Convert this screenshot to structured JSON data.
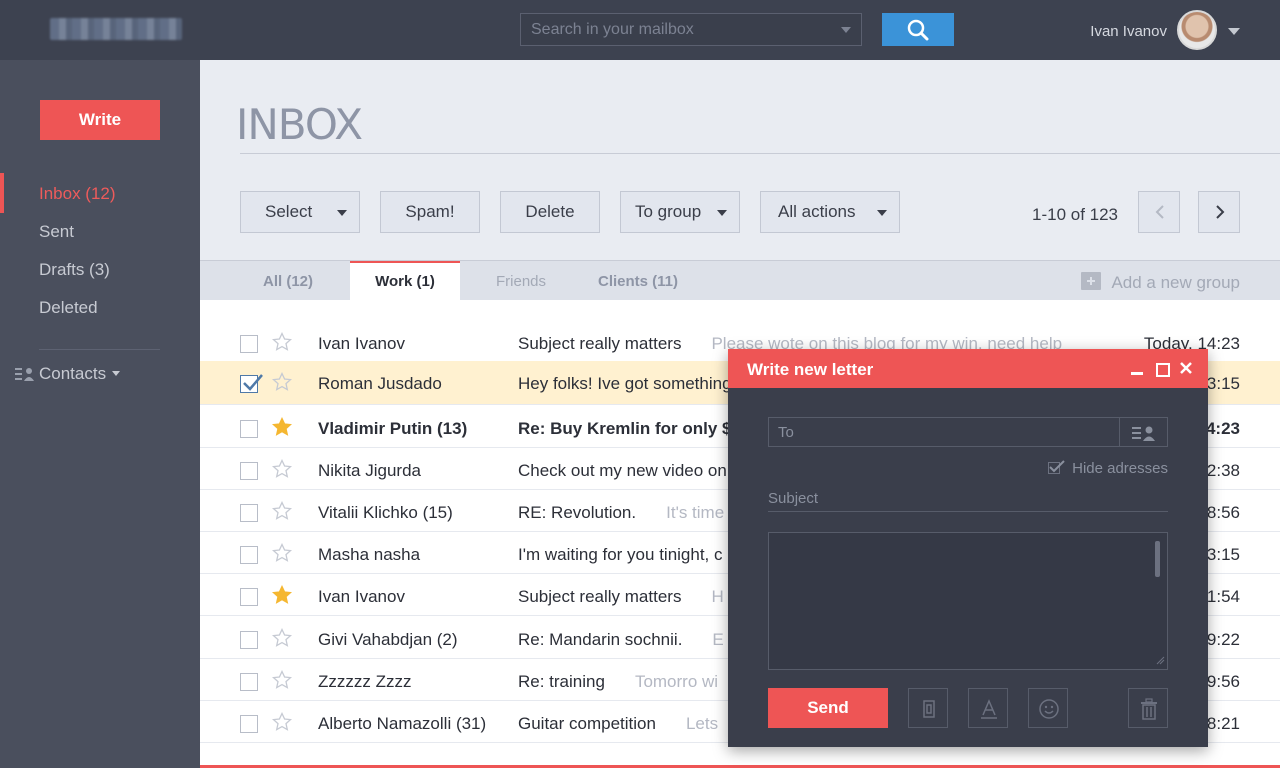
{
  "header": {
    "search_placeholder": "Search in your mailbox",
    "user_name": "Ivan Ivanov"
  },
  "sidebar": {
    "write_label": "Write",
    "items": [
      {
        "label": "Inbox (12)",
        "active": true
      },
      {
        "label": "Sent"
      },
      {
        "label": "Drafts (3)"
      },
      {
        "label": "Deleted"
      }
    ],
    "contacts_label": "Contacts"
  },
  "main": {
    "title": "INBOX",
    "toolbar": {
      "select": "Select",
      "spam": "Spam!",
      "delete": "Delete",
      "to_group": "To group",
      "all_actions": "All actions"
    },
    "pager": "1-10 of 123",
    "tabs": [
      {
        "label": "All (12)"
      },
      {
        "label": "Work (1)",
        "active": true
      },
      {
        "label": "Friends"
      },
      {
        "label": "Clients (11)"
      }
    ],
    "add_group": "Add a new group",
    "messages": [
      {
        "from": "Ivan Ivanov",
        "subject": "Subject really matters",
        "preview": "Please wote on this blog for my win, need help",
        "time": "Today, 14:23",
        "checked": false,
        "starred": false,
        "unread": false
      },
      {
        "from": "Roman Jusdado",
        "subject": "Hey folks! Ive got something",
        "preview": "",
        "time": "3:15",
        "checked": true,
        "starred": false,
        "unread": false
      },
      {
        "from": "Vladimir Putin (13)",
        "subject": "Re: Buy Kremlin for only $",
        "preview": "",
        "time": "4:23",
        "checked": false,
        "starred": true,
        "unread": true
      },
      {
        "from": "Nikita Jigurda",
        "subject": "Check out my new video on",
        "preview": "",
        "time": "2:38",
        "checked": false,
        "starred": false,
        "unread": false
      },
      {
        "from": "Vitalii Klichko (15)",
        "subject": "RE: Revolution.",
        "preview": "It's time",
        "time": "8:56",
        "checked": false,
        "starred": false,
        "unread": false
      },
      {
        "from": "Masha nasha",
        "subject": "I'm waiting for you tinight, c",
        "preview": "",
        "time": "3:15",
        "checked": false,
        "starred": false,
        "unread": false
      },
      {
        "from": "Ivan Ivanov",
        "subject": "Subject really matters",
        "preview": "H",
        "time": "1:54",
        "checked": false,
        "starred": true,
        "unread": false
      },
      {
        "from": "Givi Vahabdjan (2)",
        "subject": "Re: Mandarin sochnii.",
        "preview": "E",
        "time": "9:22",
        "checked": false,
        "starred": false,
        "unread": false
      },
      {
        "from": "Zzzzzz Zzzz",
        "subject": "Re: training",
        "preview": "Tomorro wi",
        "time": "9:56",
        "checked": false,
        "starred": false,
        "unread": false
      },
      {
        "from": "Alberto Namazolli (31)",
        "subject": "Guitar competition",
        "preview": "Lets",
        "time": "8:21",
        "checked": false,
        "starred": false,
        "unread": false
      }
    ]
  },
  "compose": {
    "title": "Write new letter",
    "to_placeholder": "To",
    "hide_addresses": "Hide adresses",
    "subject_placeholder": "Subject",
    "send_label": "Send"
  },
  "colors": {
    "accent": "#ee5555",
    "search_button": "#3b93d8",
    "topbar": "#3d4250",
    "sidebar": "#4a4f5d",
    "selected_row": "#fff1d0",
    "star_active": "#f5b731"
  }
}
